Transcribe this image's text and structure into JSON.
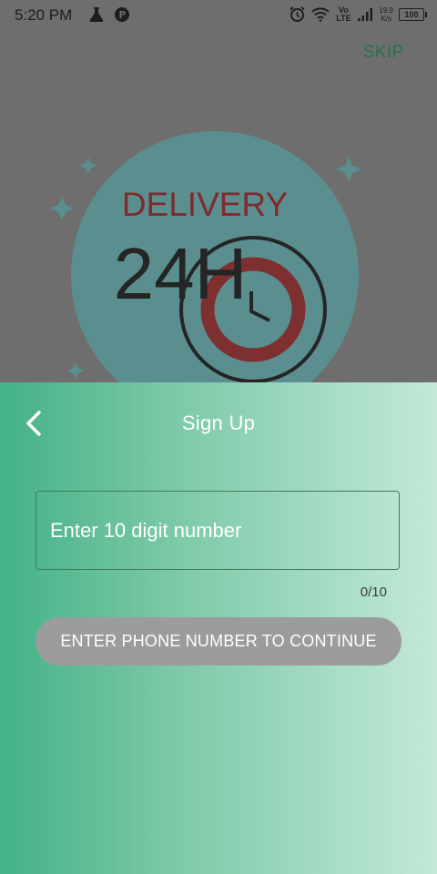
{
  "status_bar": {
    "time": "5:20 PM",
    "left_icons": [
      "flask-icon",
      "circle-r-icon"
    ],
    "right_icons": [
      "alarm-icon",
      "wifi-icon",
      "volte-icon",
      "signal-icon",
      "battery-icon"
    ],
    "volte_label": "Vo LTE",
    "net_speed_value": "19.9",
    "net_speed_unit": "K/s",
    "battery_level": "100"
  },
  "header": {
    "skip_label": "SKIP"
  },
  "illustration": {
    "title": "DELIVERY",
    "big_text": "24H",
    "colors": {
      "circle": "#5b8f8f",
      "title": "#7d2b2e",
      "ring": "#7e2f30",
      "text": "#252525"
    }
  },
  "signup": {
    "title": "Sign Up",
    "back_icon": "chevron-left-icon",
    "phone_placeholder": "Enter 10 digit number",
    "phone_value": "",
    "counter": "0/10",
    "continue_label": "ENTER PHONE NUMBER TO CONTINUE",
    "colors": {
      "gradient_start": "#43b286",
      "gradient_end": "#c4e8d9",
      "button_disabled": "#9c9c9c"
    }
  }
}
